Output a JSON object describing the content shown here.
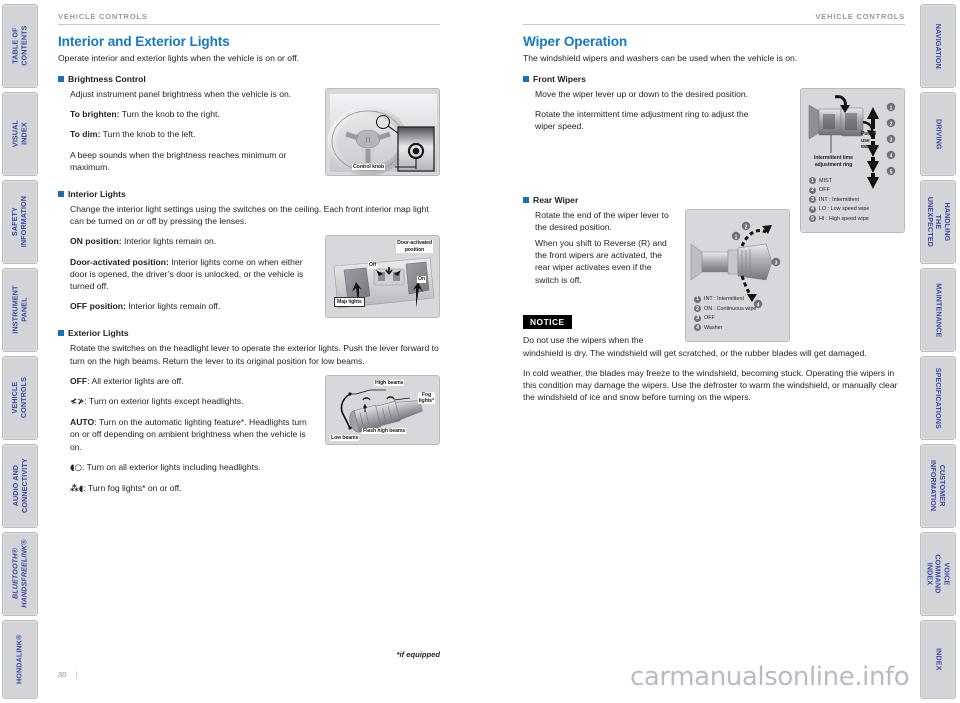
{
  "page": {
    "number": "30",
    "footnote": "*if equipped",
    "watermark": "carmanualsonline.info"
  },
  "left_rail": [
    {
      "label": "TABLE OF CONTENTS"
    },
    {
      "label": "VISUAL INDEX"
    },
    {
      "label": "SAFETY\nINFORMATION"
    },
    {
      "label": "INSTRUMENT PANEL"
    },
    {
      "label": "VEHICLE\nCONTROLS"
    },
    {
      "label": "AUDIO AND\nCONNECTIVITY"
    },
    {
      "label": "BLUETOOTH®\nHANDSFREELINK®",
      "italic": true
    },
    {
      "label": "HONDALINK®"
    }
  ],
  "right_rail": [
    {
      "label": "NAVIGATION"
    },
    {
      "label": "DRIVING"
    },
    {
      "label": "HANDLING THE\nUNEXPECTED"
    },
    {
      "label": "MAINTENANCE"
    },
    {
      "label": "SPECIFICATIONS"
    },
    {
      "label": "CUSTOMER\nINFORMATION"
    },
    {
      "label": "VOICE COMMAND\nINDEX"
    },
    {
      "label": "INDEX"
    }
  ],
  "left_column": {
    "breadcrumb": "VEHICLE CONTROLS",
    "title": "Interior and Exterior Lights",
    "intro": "Operate interior and exterior lights when the vehicle is on or off.",
    "brightness": {
      "heading": "Brightness Control",
      "p1": "Adjust instrument panel brightness when the vehicle is on.",
      "p2_label": "To brighten:",
      "p2_text": " Turn the knob to the right.",
      "p3_label": "To dim:",
      "p3_text": " Turn the knob to the left.",
      "p4": "A beep sounds when the brightness reaches minimum or maximum.",
      "figure_caption": "Control knob"
    },
    "interior": {
      "heading": "Interior Lights",
      "p1": "Change the interior light settings using the switches on the ceiling. Each front interior map light can be turned on or off by pressing the lenses.",
      "p2_label": "ON position:",
      "p2_text": " Interior lights remain on.",
      "p3_label": "Door-activated position:",
      "p3_text": " Interior lights come on when either door is opened, the driver’s door is unlocked, or the vehicle is turned off.",
      "p4_label": "OFF position:",
      "p4_text": " Interior lights remain off.",
      "figure_captions": {
        "door_activated": "Door-activated\nposition",
        "off": "Off",
        "on": "On",
        "map_lights": "Map lights"
      }
    },
    "exterior": {
      "heading": "Exterior Lights",
      "p1": "Rotate the switches on the headlight lever to operate the exterior lights. Push the lever forward to turn on the high beams. Return the lever to its original position for low beams.",
      "items": [
        {
          "symbol": "OFF",
          "symbol_kind": "text",
          "text": ": All exterior lights are off."
        },
        {
          "symbol": "position-lights-symbol",
          "symbol_kind": "icon",
          "text": ": Turn on exterior lights except headlights."
        },
        {
          "symbol": "AUTO",
          "symbol_kind": "text",
          "text": ": Turn on the automatic lighting feature*. Headlights turn on or off depending on ambient brightness when the vehicle is on."
        },
        {
          "symbol": "headlight-symbol",
          "symbol_kind": "icon",
          "text": ": Turn on all exterior lights including headlights."
        },
        {
          "symbol": "fog-light-symbol",
          "symbol_kind": "icon",
          "text": ": Turn fog lights* on or off."
        }
      ],
      "figure_captions": {
        "high_beams": "High beams",
        "fog_lights": "Fog\nlights*",
        "flash_high_beams": "Flash high beams",
        "low_beams": "Low beams"
      }
    }
  },
  "right_column": {
    "breadcrumb": "VEHICLE CONTROLS",
    "title": "Wiper Operation",
    "intro": "The windshield wipers and washers can be used when the vehicle is on.",
    "front_wipers": {
      "heading": "Front Wipers",
      "p1": "Move the wiper lever up or down to the desired position.",
      "p2": "Rotate the intermittent time adjustment ring to adjust the wiper speed.",
      "figure_captions": {
        "pull_to_use_washer": "Pull to\nuse\nwasher.",
        "ring": "Intermittent time\nadjustment ring"
      },
      "legend": [
        {
          "num": "1",
          "text": "MIST"
        },
        {
          "num": "2",
          "text": "OFF"
        },
        {
          "num": "3",
          "text": "INT : Intermittent"
        },
        {
          "num": "4",
          "text": "LO : Low speed wipe"
        },
        {
          "num": "5",
          "text": "HI : High speed wipe"
        }
      ]
    },
    "rear_wiper": {
      "heading": "Rear Wiper",
      "p1": "Rotate the end of the wiper lever to the desired position.",
      "p2": "When you shift to Reverse (R) and the front wipers are activated, the rear wiper activates even if the switch is off.",
      "legend": [
        {
          "num": "1",
          "text": "INT : Intermittent"
        },
        {
          "num": "2",
          "text": "ON : Continuous wipe"
        },
        {
          "num": "3",
          "text": "OFF"
        },
        {
          "num": "4",
          "text": "Washer"
        }
      ]
    },
    "notice": {
      "tag": "NOTICE",
      "p1": "Do not use the wipers when the windshield is dry. The windshield will get scratched, or the rubber blades will get damaged.",
      "p2": "In cold weather, the blades may freeze to the windshield, becoming stuck. Operating the wipers in this condition may damage the wipers. Use the defroster to warm the windshield, or manually clear the windshield of ice and snow before turning on the wipers."
    }
  },
  "colors": {
    "heading_blue": "#1678c2",
    "tab_text_blue": "#3b47a5",
    "tab_bg": "#d3d4d8",
    "figure_bg": "#d7d8dc",
    "body_text": "#231f20",
    "crumb_gray": "#9a9a9e"
  }
}
